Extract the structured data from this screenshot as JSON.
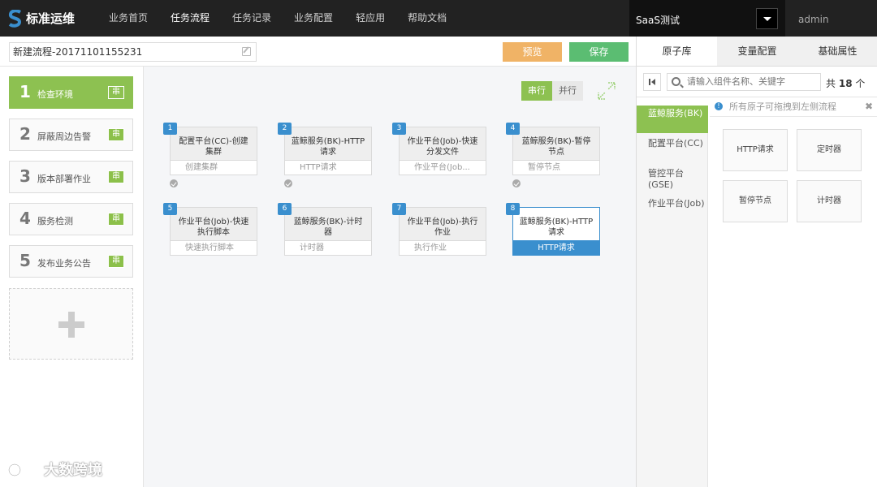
{
  "app": {
    "title": "标准运维"
  },
  "nav": {
    "items": [
      "业务首页",
      "任务流程",
      "任务记录",
      "业务配置",
      "轻应用",
      "帮助文档"
    ],
    "active": 1
  },
  "business": {
    "selected": "SaaS测试"
  },
  "user": {
    "name": "admin"
  },
  "flow": {
    "name": "新建流程-20171101155231",
    "preview_label": "预览",
    "save_label": "保存"
  },
  "stages": [
    {
      "num": "1",
      "name": "检查环境",
      "tag": "串",
      "active": true
    },
    {
      "num": "2",
      "name": "屏蔽周边告警",
      "tag": "串"
    },
    {
      "num": "3",
      "name": "版本部署作业",
      "tag": "串"
    },
    {
      "num": "4",
      "name": "服务检测",
      "tag": "串"
    },
    {
      "num": "5",
      "name": "发布业务公告",
      "tag": "串"
    }
  ],
  "mode": {
    "serial": "串行",
    "parallel": "并行"
  },
  "nodes": [
    {
      "idx": "1",
      "title": "配置平台(CC)-创建集群",
      "sub": "创建集群",
      "checked": true
    },
    {
      "idx": "2",
      "title": "蓝鲸服务(BK)-HTTP请求",
      "sub": "HTTP请求",
      "checked": true
    },
    {
      "idx": "3",
      "title": "作业平台(Job)-快速分发文件",
      "sub": "作业平台(Job...",
      "checked": false
    },
    {
      "idx": "4",
      "title": "蓝鲸服务(BK)-暂停节点",
      "sub": "暂停节点",
      "checked": true
    },
    {
      "idx": "5",
      "title": "作业平台(Job)-快速执行脚本",
      "sub": "快速执行脚本",
      "checked": false
    },
    {
      "idx": "6",
      "title": "蓝鲸服务(BK)-计时器",
      "sub": "计时器",
      "checked": false
    },
    {
      "idx": "7",
      "title": "作业平台(Job)-执行作业",
      "sub": "执行作业",
      "checked": false
    },
    {
      "idx": "8",
      "title": "蓝鲸服务(BK)-HTTP请求",
      "sub": "HTTP请求",
      "checked": false,
      "selected": true
    }
  ],
  "panel": {
    "tabs": [
      "原子库",
      "变量配置",
      "基础属性"
    ],
    "search_placeholder": "请输入组件名称、关键字",
    "count_prefix": "共",
    "count": "18",
    "count_suffix": "个",
    "categories": [
      "蓝鲸服务(BK)",
      "配置平台(CC)",
      "管控平台(GSE)",
      "作业平台(Job)"
    ],
    "hint": "所有原子可拖拽到左侧流程",
    "atoms": [
      "HTTP请求",
      "定时器",
      "暂停节点",
      "计时器"
    ]
  },
  "watermark": "大数跨境",
  "colors": {
    "green": "#8dc151",
    "blue": "#3a8fce",
    "orange": "#f0b366",
    "save": "#5bbd72"
  }
}
